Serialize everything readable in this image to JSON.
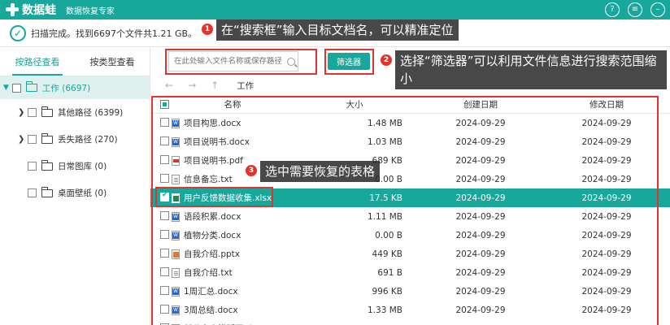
{
  "titlebar": {
    "logo_text": "数据蛙",
    "subtitle": "数据恢复专家",
    "colors": {
      "accent": "#17a79b",
      "annotation": "#e5322d"
    }
  },
  "status": {
    "text": "扫描完成。找到6697个文件共1.21 GB。"
  },
  "left_panel": {
    "tabs": [
      {
        "label": "按路径查看"
      },
      {
        "label": "按类型查看"
      }
    ],
    "root": {
      "label": "工作 (6697)"
    },
    "items": [
      {
        "label": "其他路径 (6399)",
        "expandable": true
      },
      {
        "label": "丢失路径 (270)",
        "expandable": true
      },
      {
        "label": "日常图库 (0)",
        "expandable": false
      },
      {
        "label": "桌面壁纸 (0)",
        "expandable": false
      }
    ]
  },
  "toolbar": {
    "search_placeholder": "在此处输入文件名称或保存路径",
    "filter_label": "筛选器"
  },
  "nav": {
    "back": "←",
    "forward": "→",
    "up": "↑",
    "breadcrumb": "工作"
  },
  "table": {
    "headers": {
      "name": "名称",
      "size": "大小",
      "created": "创建日期",
      "modified": "修改日期"
    },
    "rows": [
      {
        "name": "项目构思.docx",
        "type": "docx",
        "size": "1.48 MB",
        "created": "2024-09-29",
        "modified": "2024-09-29",
        "selected": false
      },
      {
        "name": "项目说明书.docx",
        "type": "docx",
        "size": "1.03 MB",
        "created": "2024-09-29",
        "modified": "2024-09-29",
        "selected": false
      },
      {
        "name": "项目说明书.pdf",
        "type": "pdf",
        "size": "689 KB",
        "created": "2024-09-29",
        "modified": "2024-09-29",
        "selected": false
      },
      {
        "name": "信息备忘.txt",
        "type": "txt",
        "size": "0.00 B",
        "created": "2024-09-29",
        "modified": "2024-09-29",
        "selected": false
      },
      {
        "name": "用户反馈数据收集.xlsx",
        "type": "xlsx",
        "size": "17.5 KB",
        "created": "2024-09-29",
        "modified": "2024-09-29",
        "selected": true
      },
      {
        "name": "语段积累.docx",
        "type": "docx",
        "size": "1.11 MB",
        "created": "2024-09-29",
        "modified": "2024-09-29",
        "selected": false
      },
      {
        "name": "植物分类.docx",
        "type": "docx",
        "size": "0.00 B",
        "created": "2024-09-29",
        "modified": "2024-09-29",
        "selected": false
      },
      {
        "name": "自我介绍.pptx",
        "type": "pptx",
        "size": "449 KB",
        "created": "2024-09-29",
        "modified": "2024-09-29",
        "selected": false
      },
      {
        "name": "自我介绍.txt",
        "type": "txt",
        "size": "691 B",
        "created": "2024-09-29",
        "modified": "2024-09-29",
        "selected": false
      },
      {
        "name": "1周汇总.docx",
        "type": "docx",
        "size": "996 KB",
        "created": "2024-09-29",
        "modified": "2024-09-29",
        "selected": false
      },
      {
        "name": "3周总结.docx",
        "type": "docx",
        "size": "1.33 MB",
        "created": "2024-09-29",
        "modified": "2024-09-29",
        "selected": false
      },
      {
        "name": "部分文本模版图形.txt",
        "type": "txt",
        "size": "387 B",
        "created": "2024-09-29",
        "modified": "2024-09-29",
        "selected": false
      }
    ]
  },
  "annotations": [
    {
      "num": "1",
      "text": "在“搜索框”输入目标文档名，可以精准定位"
    },
    {
      "num": "2",
      "text": "选择“筛选器”可以利用文件信息进行搜索范围缩小"
    },
    {
      "num": "3",
      "text": "选中需要恢复的表格"
    }
  ]
}
